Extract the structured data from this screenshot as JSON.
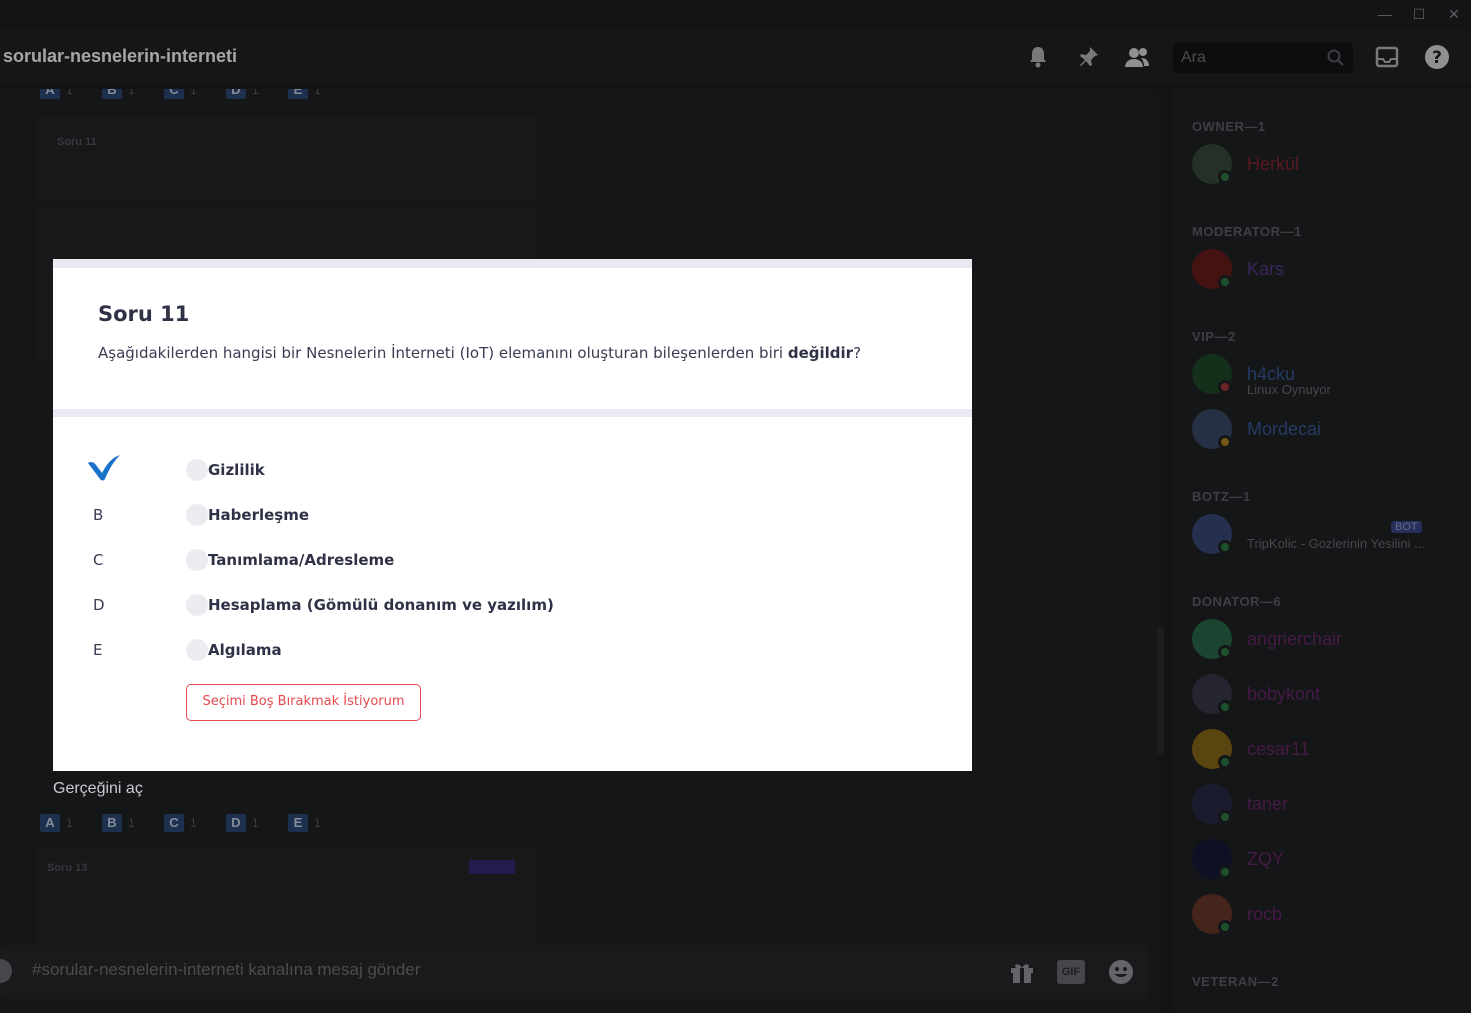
{
  "window": {
    "minimize": "—",
    "maximize": "☐",
    "close": "✕"
  },
  "header": {
    "channel": "sorular-nesnelerin-interneti",
    "search_placeholder": "Ara"
  },
  "chat": {
    "answer_rows": [
      {
        "letters": [
          "A",
          "B",
          "C",
          "D",
          "E"
        ],
        "counts": [
          "1",
          "1",
          "1",
          "1",
          "1"
        ]
      },
      {
        "letters": [
          "A",
          "B",
          "C",
          "D",
          "E"
        ],
        "counts": [
          "1",
          "1",
          "1",
          "1",
          "1"
        ]
      }
    ],
    "prev_question_title": "Soru 11",
    "next_question_title": "Soru 13",
    "reveal_link": "Gerçeğini aç",
    "message_placeholder": "#sorular-nesnelerin-interneti kanalına mesaj gönder",
    "gif_label": "GIF"
  },
  "members": {
    "groups": [
      {
        "title": "OWNER—1",
        "members": [
          {
            "name": "Herkül",
            "color": "#8a2630",
            "sub": "",
            "status": "online",
            "avatar_color": "#3a4a3f"
          }
        ]
      },
      {
        "title": "MODERATOR—1",
        "members": [
          {
            "name": "Kars",
            "color": "#5a3a8a",
            "sub": "",
            "status": "online",
            "avatar_color": "#6b1c1c"
          }
        ]
      },
      {
        "title": "VIP—2",
        "members": [
          {
            "name": "h4cku",
            "color": "#3a5a9a",
            "sub": "Linux Oynuyor",
            "status": "dnd",
            "avatar_color": "#1f4a2a"
          },
          {
            "name": "Mordecai",
            "color": "#3a5a9a",
            "sub": "",
            "status": "idle",
            "avatar_color": "#3a4a6a"
          }
        ]
      },
      {
        "title": "BOTZ—1",
        "members": [
          {
            "name": "",
            "color": "#5e6167",
            "sub": "TripKolic - Gozlerinin Yesilini ...",
            "status": "online",
            "avatar_color": "#3a4a7a",
            "bot": "BOT"
          }
        ]
      },
      {
        "title": "DONATOR—6",
        "members": [
          {
            "name": "angrierchair",
            "color": "#6a2a6a",
            "sub": "",
            "status": "online",
            "avatar_color": "#2a6a4a"
          },
          {
            "name": "bobykont",
            "color": "#6a2a6a",
            "sub": "",
            "status": "online",
            "avatar_color": "#3a3a4a"
          },
          {
            "name": "cesar11",
            "color": "#6a2a6a",
            "sub": "",
            "status": "online",
            "avatar_color": "#8a6a1a"
          },
          {
            "name": "taner",
            "color": "#6a2a6a",
            "sub": "",
            "status": "online",
            "avatar_color": "#2a2a4a"
          },
          {
            "name": "ZQY",
            "color": "#6a2a6a",
            "sub": "",
            "status": "online",
            "avatar_color": "#1a1a3a"
          },
          {
            "name": "rocb",
            "color": "#6a2a6a",
            "sub": "",
            "status": "online",
            "avatar_color": "#6a3a2a"
          }
        ]
      },
      {
        "title": "VETERAN—2",
        "members": []
      }
    ]
  },
  "modal": {
    "title": "Soru 11",
    "question_prefix": "Aşağıdakilerden hangisi bir Nesnelerin İnterneti (IoT) elemanını oluşturan bileşenlerden biri ",
    "question_bold": "değildir",
    "question_suffix": "?",
    "options": [
      {
        "letter": "",
        "label": "Gizlilik",
        "selected": true
      },
      {
        "letter": "B",
        "label": "Haberleşme",
        "selected": false
      },
      {
        "letter": "C",
        "label": "Tanımlama/Adresleme",
        "selected": false
      },
      {
        "letter": "D",
        "label": "Hesaplama (Gömülü donanım ve yazılım)",
        "selected": false
      },
      {
        "letter": "E",
        "label": "Algılama",
        "selected": false
      }
    ],
    "skip_label": "Seçimi Boş Bırakmak İstiyorum",
    "accent": "#1a73c9",
    "danger": "#e5484d"
  }
}
